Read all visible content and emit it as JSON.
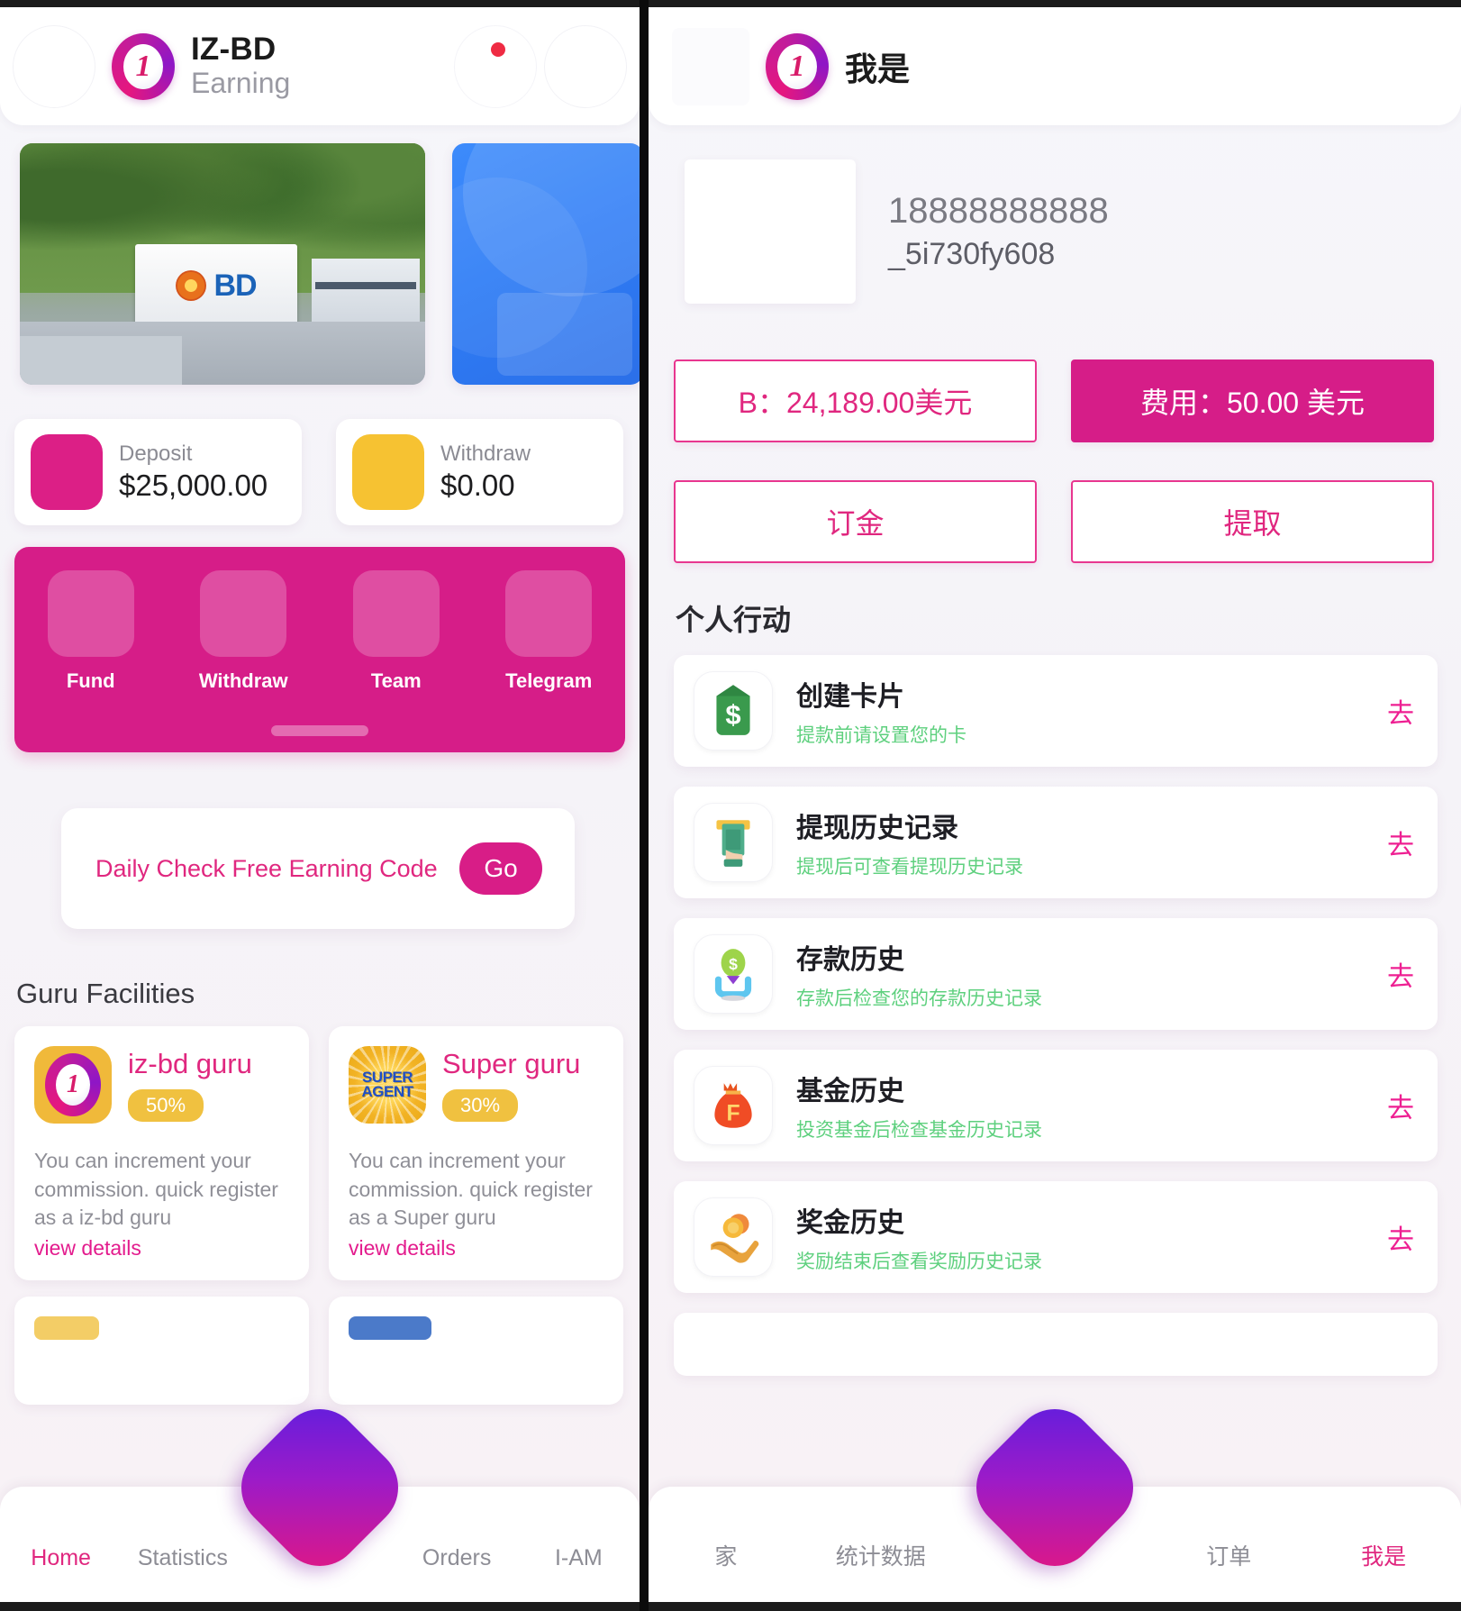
{
  "left": {
    "topbar": {
      "logo_number": "1",
      "title": "IZ-BD",
      "subtitle": "Earning",
      "notification_dot": "•"
    },
    "banners": [
      {
        "name": "bd-campus-banner",
        "caption": "BD"
      },
      {
        "name": "blue-promo-banner",
        "caption": ""
      }
    ],
    "stats": [
      {
        "label": "Deposit",
        "value": "$25,000.00",
        "color": "#dc1f86"
      },
      {
        "label": "Withdraw",
        "value": "$0.00",
        "color": "#f6c232"
      }
    ],
    "quick_actions": [
      {
        "label": "Fund"
      },
      {
        "label": "Withdraw"
      },
      {
        "label": "Team"
      },
      {
        "label": "Telegram"
      }
    ],
    "daily_check": {
      "text": "Daily Check Free Earning Code",
      "button": "Go"
    },
    "guru": {
      "section_title": "Guru Facilities",
      "cards": [
        {
          "name": "iz-bd guru",
          "percent": "50%",
          "description": "You can increment your commission. quick register as a iz-bd guru",
          "link": "view details",
          "badge_text": "1"
        },
        {
          "name": "Super guru",
          "percent": "30%",
          "description": "You can increment your commission. quick register as a Super guru",
          "link": "view details",
          "badge_text": "SUPER AGENT"
        }
      ]
    },
    "bottom_nav": [
      {
        "label": "Home",
        "active": true
      },
      {
        "label": "Statistics",
        "active": false
      },
      {
        "label": "Orders",
        "active": false
      },
      {
        "label": "I-AM",
        "active": false
      }
    ]
  },
  "right": {
    "topbar": {
      "logo_number": "1",
      "title": "我是"
    },
    "profile": {
      "phone": "18888888888",
      "uid": "_5i730fy608"
    },
    "balance_buttons": [
      {
        "label": "B：24,189.00美元",
        "style": "outline"
      },
      {
        "label": "费用：50.00 美元",
        "style": "filled"
      },
      {
        "label": "订金",
        "style": "outline"
      },
      {
        "label": "提取",
        "style": "outline"
      }
    ],
    "actions": {
      "section_title": "个人行动",
      "go_label": "去",
      "items": [
        {
          "title": "创建卡片",
          "subtitle": "提款前请设置您的卡",
          "icon": "money-tag-icon"
        },
        {
          "title": "提现历史记录",
          "subtitle": "提现后可查看提现历史记录",
          "icon": "cash-withdraw-icon"
        },
        {
          "title": "存款历史",
          "subtitle": "存款后检查您的存款历史记录",
          "icon": "deposit-coin-icon"
        },
        {
          "title": "基金历史",
          "subtitle": "投资基金后检查基金历史记录",
          "icon": "money-bag-icon"
        },
        {
          "title": "奖金历史",
          "subtitle": "奖励结束后查看奖励历史记录",
          "icon": "coins-hand-icon"
        }
      ]
    },
    "bottom_nav": [
      {
        "label": "家",
        "active": false
      },
      {
        "label": "统计数据",
        "active": false
      },
      {
        "label": "订单",
        "active": false
      },
      {
        "label": "我是",
        "active": true
      }
    ]
  },
  "colors": {
    "brand_pink": "#d61d88",
    "accent_pink": "#e0277f",
    "yellow": "#f6c232",
    "green_sub": "#5ed07e",
    "blue": "#3d8bfb"
  }
}
